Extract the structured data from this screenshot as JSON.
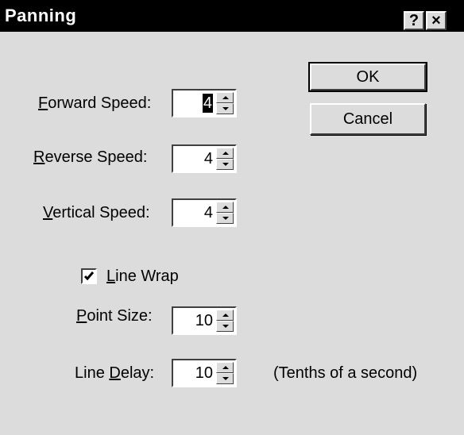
{
  "window": {
    "title": "Panning",
    "help_glyph": "?",
    "close_glyph": "×"
  },
  "buttons": {
    "ok": "OK",
    "cancel": "Cancel"
  },
  "fields": {
    "forward_speed": {
      "label_u": "F",
      "label_rest": "orward Speed:",
      "value": "4",
      "selected": true
    },
    "reverse_speed": {
      "label_u": "R",
      "label_rest": "everse Speed:",
      "value": "4"
    },
    "vertical_speed": {
      "label_u": "V",
      "label_rest": "ertical Speed:",
      "value": "4"
    },
    "point_size": {
      "label_u": "P",
      "label_rest": "oint Size:",
      "value": "10"
    },
    "line_delay": {
      "label_pre": "Line ",
      "label_u": "D",
      "label_rest": "elay:",
      "value": "10",
      "units": "(Tenths of a second)"
    }
  },
  "line_wrap": {
    "label_u": "L",
    "label_rest": "ine Wrap",
    "checked": true
  },
  "icons": [
    "help-icon",
    "close-icon",
    "spin-up-icon",
    "spin-down-icon",
    "checkmark-icon"
  ]
}
